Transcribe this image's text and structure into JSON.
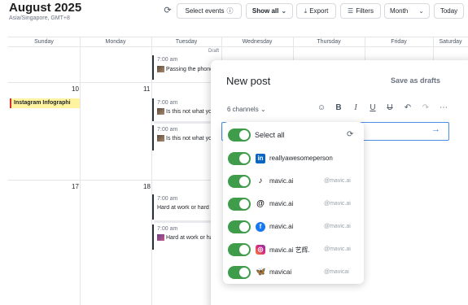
{
  "header": {
    "title": "August 2025",
    "timezone": "Asia/Singapore, GMT+8",
    "buttons": {
      "select_events": "Select events",
      "show_all": "Show all",
      "export": "Export",
      "filters": "Filters",
      "view": "Month",
      "today": "Today"
    }
  },
  "calendar": {
    "days": [
      "Sunday",
      "Monday",
      "Tuesday",
      "Wednesday",
      "Thursday",
      "Friday",
      "Saturday"
    ],
    "dates": {
      "d10": "10",
      "d11": "11",
      "d17": "17",
      "d18": "18"
    },
    "events": {
      "ig_chip": "Instagram Infographi",
      "draft_label": "Draft",
      "e1_time": "7:00 am",
      "e1_text": "Passing the phone",
      "e2_time": "7:00 am",
      "e2_text": "Is this not what you",
      "e3_time": "7:00 am",
      "e3_text": "Is this not what you",
      "e4_time": "7:00 am",
      "e4_text": "Hard at work or hard",
      "e5_time": "7:00 am",
      "e5_text": "Hard at work or hard"
    }
  },
  "composer": {
    "title": "New post",
    "save_drafts": "Save as drafts",
    "channels_label": "6 channels",
    "select_all": "Select all",
    "channels": [
      {
        "name": "reallyawesomeperson",
        "handle": "",
        "icon": "linkedin-icon",
        "color": "#0a66c2"
      },
      {
        "name": "mavic.ai",
        "handle": "@mavic.ai",
        "icon": "tiktok-icon",
        "color": "#111111"
      },
      {
        "name": "mavic.ai",
        "handle": "@mavic.ai",
        "icon": "threads-icon",
        "color": "#111111"
      },
      {
        "name": "mavic.ai",
        "handle": "@mavic.ai",
        "icon": "facebook-icon",
        "color": "#1877f2"
      },
      {
        "name": "mavic.ai 艺辉.",
        "handle": "@mavic.ai",
        "icon": "instagram-icon",
        "color": "#d6249f"
      },
      {
        "name": "mavicai",
        "handle": "@mavicai",
        "icon": "bluesky-icon",
        "color": "#1185fe"
      }
    ]
  }
}
